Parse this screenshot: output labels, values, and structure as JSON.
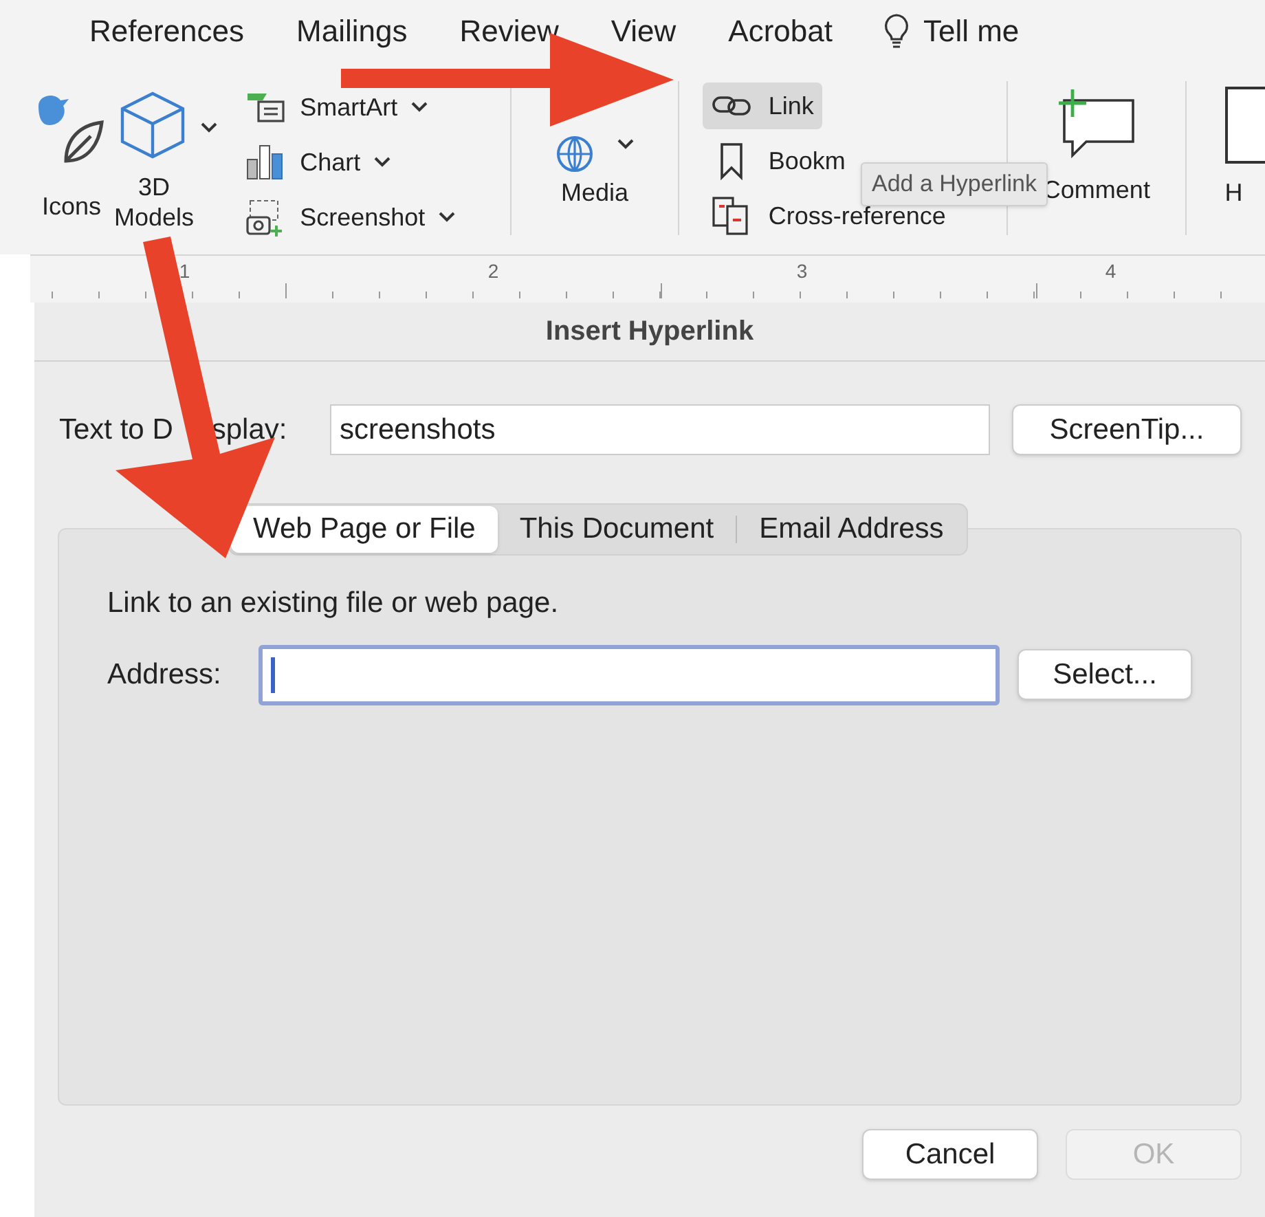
{
  "tabs": [
    {
      "label": "References",
      "kind": "tab"
    },
    {
      "label": "Mailings",
      "kind": "tab"
    },
    {
      "label": "Review",
      "kind": "tab"
    },
    {
      "label": "View",
      "kind": "tab"
    },
    {
      "label": "Acrobat",
      "kind": "tab"
    },
    {
      "label": "Tell me",
      "kind": "search"
    }
  ],
  "ribbon": {
    "large_left": [
      {
        "label": "Icons",
        "kind": "icons"
      },
      {
        "label": "3D",
        "label_2": "Models",
        "kind": "cube"
      }
    ],
    "illustrations": [
      {
        "label": "SmartArt",
        "kind": "smartart"
      },
      {
        "label": "Chart",
        "kind": "chart"
      },
      {
        "label": "Screenshot",
        "kind": "screenshot"
      }
    ],
    "media": {
      "label": "Media"
    },
    "links": [
      {
        "label": "Link",
        "kind": "link",
        "selected": true
      },
      {
        "label": "Bookm",
        "kind": "bookmark",
        "selected": false
      },
      {
        "label": "Cross-reference",
        "kind": "crossref",
        "selected": false
      }
    ],
    "comment": {
      "label": "Comment"
    },
    "cut_item": {
      "label": "H"
    },
    "tooltip": "Add a Hyperlink"
  },
  "ruler": [
    "1",
    "2",
    "3",
    "4"
  ],
  "dialog": {
    "title": "Insert Hyperlink",
    "text_to_display": {
      "label": "Text to D",
      "label_rest": "splay:",
      "value": "screenshots"
    },
    "screentip_button": "ScreenTip...",
    "tabs": [
      {
        "label": "Web Page or File",
        "selected": true
      },
      {
        "label": "This Document",
        "selected": false
      },
      {
        "label": "Email Address",
        "selected": false
      }
    ],
    "hint": "Link to an existing file or web page.",
    "address": {
      "label": "Address:"
    },
    "select_button": "Select...",
    "buttons": [
      {
        "label": "Cancel",
        "disabled": false
      },
      {
        "label": "OK",
        "disabled": true
      }
    ]
  }
}
